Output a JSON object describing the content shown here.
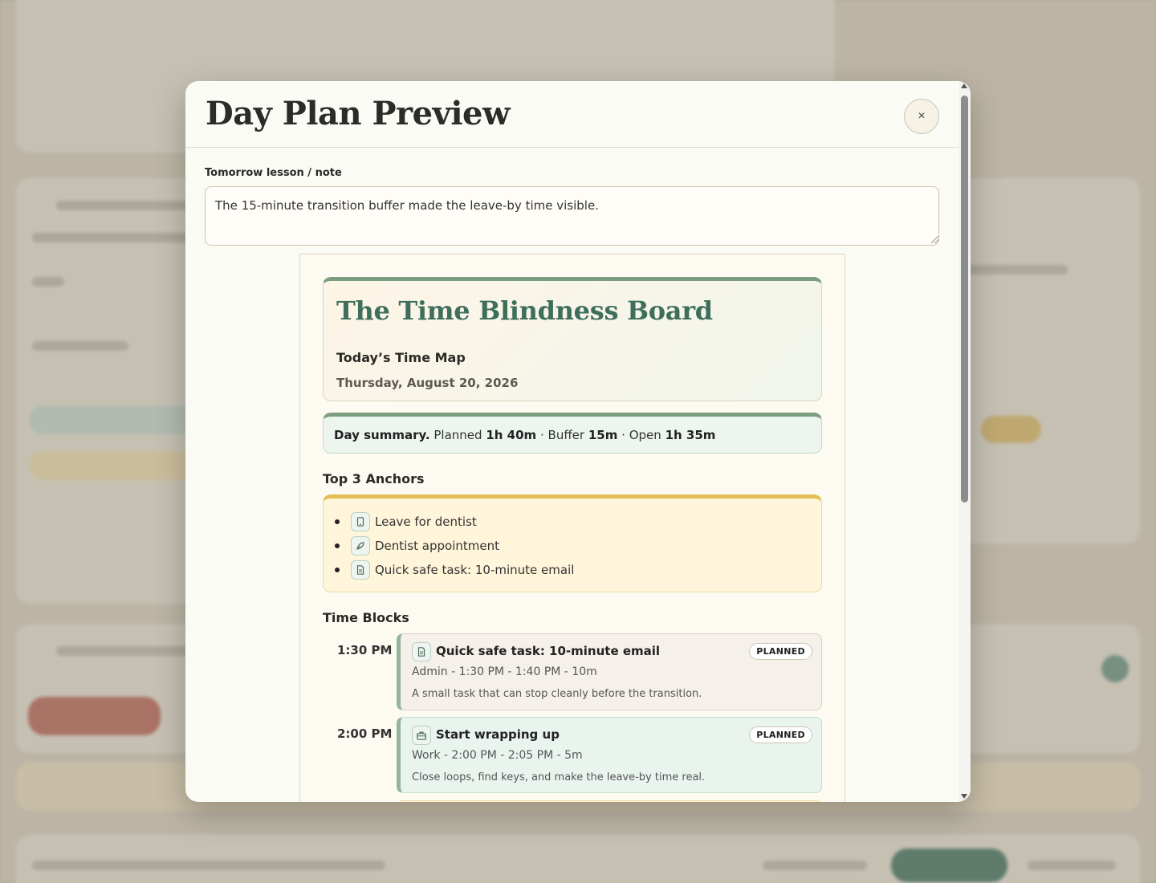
{
  "modal": {
    "title": "Day Plan Preview",
    "close_label": "×",
    "note_label": "Tomorrow lesson / note",
    "note_value": "The 15-minute transition buffer made the leave-by time visible."
  },
  "preview": {
    "app_title": "The Time Blindness Board",
    "subtitle": "Today’s Time Map",
    "date": "Thursday, August 20, 2026",
    "summary": {
      "label": "Day summary.",
      "planned_label": "Planned",
      "planned_value": "1h 40m",
      "sep1": "·",
      "buffer_label": "Buffer",
      "buffer_value": "15m",
      "sep2": "·",
      "open_label": "Open",
      "open_value": "1h 35m"
    },
    "anchors_heading": "Top 3 Anchors",
    "anchors": [
      {
        "icon": "phone-icon",
        "label": "Leave for dentist"
      },
      {
        "icon": "leaf-icon",
        "label": "Dentist appointment"
      },
      {
        "icon": "document-icon",
        "label": "Quick safe task: 10-minute email"
      }
    ],
    "blocks_heading": "Time Blocks",
    "blocks": [
      {
        "time": "1:30 PM",
        "icon": "document-icon",
        "title": "Quick safe task: 10-minute email",
        "status": "PLANNED",
        "meta": "Admin - 1:30 PM - 1:40 PM - 10m",
        "description": "A small task that can stop cleanly before the transition."
      },
      {
        "time": "2:00 PM",
        "icon": "briefcase-icon",
        "title": "Start wrapping up",
        "status": "PLANNED",
        "meta": "Work - 2:00 PM - 2:05 PM - 5m",
        "description": "Close loops, find keys, and make the leave-by time real."
      }
    ]
  },
  "colors": {
    "accent_green": "#3e6e5c",
    "summary_border": "#7d9d80",
    "anchor_border": "#e3be55",
    "anchor_bg": "#fff5da"
  }
}
